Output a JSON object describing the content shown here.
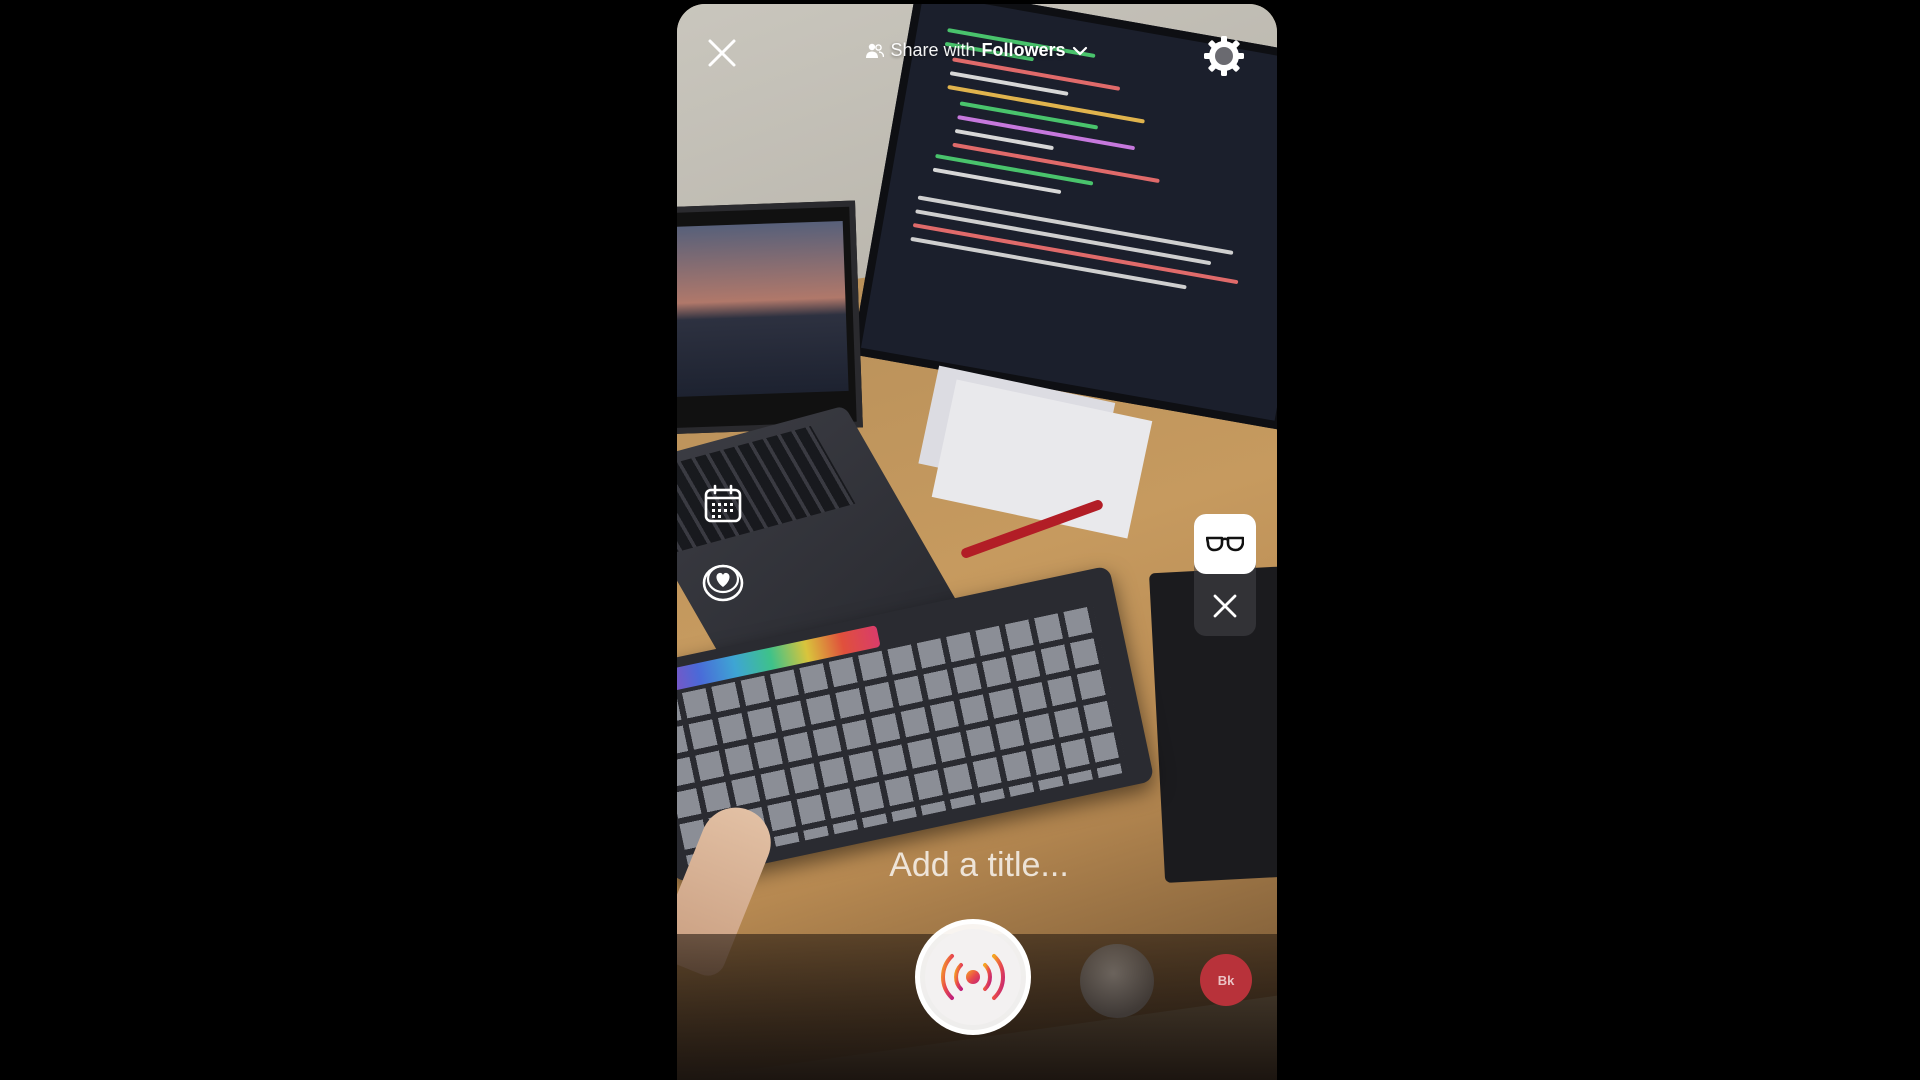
{
  "header": {
    "share_prefix": "Share with",
    "share_audience": "Followers",
    "icons": {
      "close": "close-icon",
      "people": "people-icon",
      "chevron": "chevron-down-icon",
      "settings": "gear-icon"
    }
  },
  "side_tools": [
    {
      "name": "schedule",
      "icon": "calendar-icon"
    },
    {
      "name": "donations",
      "icon": "heart-coin-icon"
    }
  ],
  "effect_panel": {
    "active_effect_icon": "glasses-icon",
    "remove_icon": "close-icon"
  },
  "title_field": {
    "placeholder": "Add a title...",
    "value": ""
  },
  "bottom_bar": {
    "record_icon": "live-broadcast-icon",
    "avatar_label": "Bk"
  },
  "colors": {
    "live_gradient_start": "#f5a623",
    "live_gradient_end": "#d8206b",
    "avatar_bg": "#b8323a"
  }
}
